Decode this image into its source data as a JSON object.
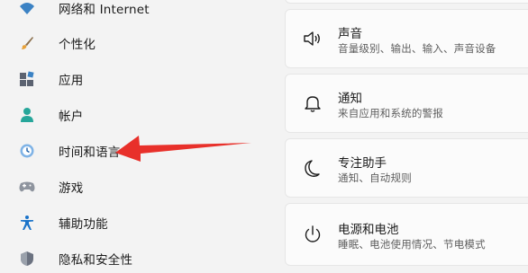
{
  "sidebar": {
    "items": [
      {
        "label": "网络和 Internet",
        "icon": "wifi-icon"
      },
      {
        "label": "个性化",
        "icon": "brush-icon"
      },
      {
        "label": "应用",
        "icon": "apps-icon"
      },
      {
        "label": "帐户",
        "icon": "person-icon"
      },
      {
        "label": "时间和语言",
        "icon": "clock-globe-icon"
      },
      {
        "label": "游戏",
        "icon": "gamepad-icon"
      },
      {
        "label": "辅助功能",
        "icon": "accessibility-icon"
      },
      {
        "label": "隐私和安全性",
        "icon": "shield-icon"
      }
    ]
  },
  "cards": [
    {
      "title": "声音",
      "subtitle": "音量级别、输出、输入、声音设备",
      "icon": "speaker-icon"
    },
    {
      "title": "通知",
      "subtitle": "来自应用和系统的警报",
      "icon": "bell-icon"
    },
    {
      "title": "专注助手",
      "subtitle": "通知、自动规则",
      "icon": "moon-icon"
    },
    {
      "title": "电源和电池",
      "subtitle": "睡眠、电池使用情况、节电模式",
      "icon": "power-icon"
    }
  ],
  "colors": {
    "accent": "#0067c0",
    "annotation_arrow": "#e8302a"
  }
}
